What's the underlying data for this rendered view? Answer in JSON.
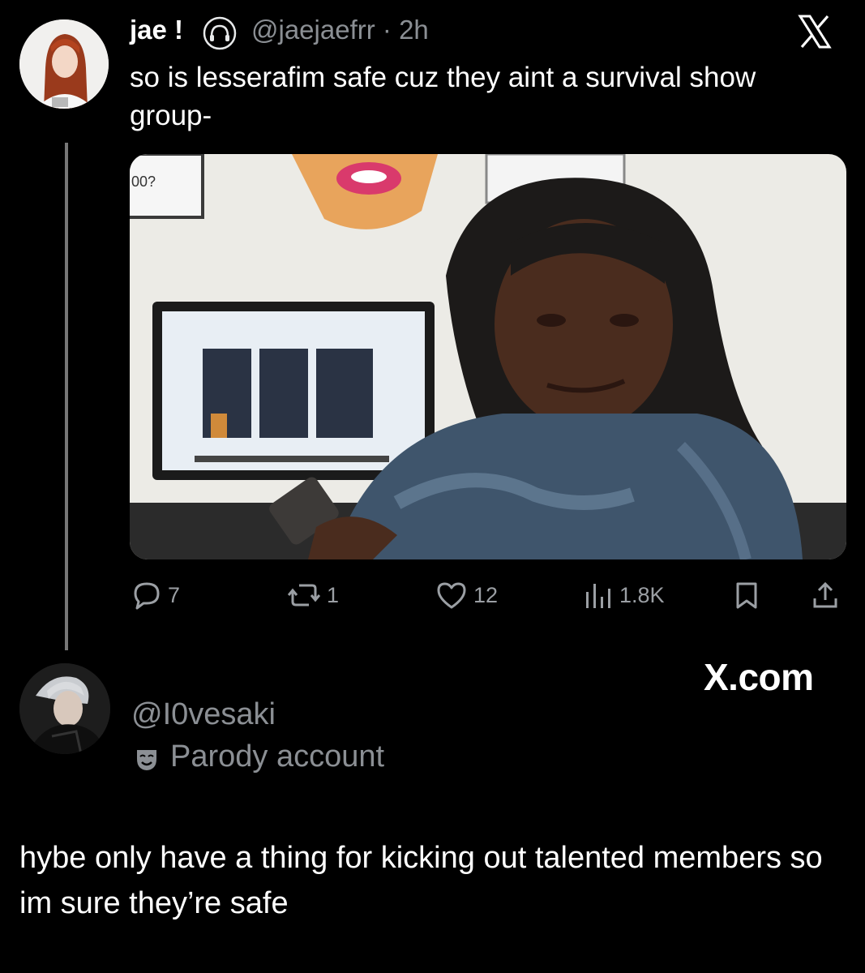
{
  "tweet": {
    "display_name": "jae !",
    "badge_icon": "headphones-icon",
    "handle": "@jaejaefrr",
    "time": "· 2h",
    "text": "so is lesserafim safe cuz they aint a survival show group-",
    "media": {
      "label": "reaction-gif",
      "sign_text": "00?"
    },
    "actions": {
      "replies": "7",
      "reposts": "1",
      "likes": "12",
      "views": "1.8K"
    }
  },
  "watermark": "X.com",
  "reply": {
    "handle": "@I0vesaki",
    "badge": "Parody account",
    "text": "hybe only have a thing for kicking out talented members so im sure they’re safe"
  },
  "colors": {
    "background": "#000000",
    "text": "#ffffff",
    "muted": "#8b8f94",
    "thread_line": "#777777"
  }
}
